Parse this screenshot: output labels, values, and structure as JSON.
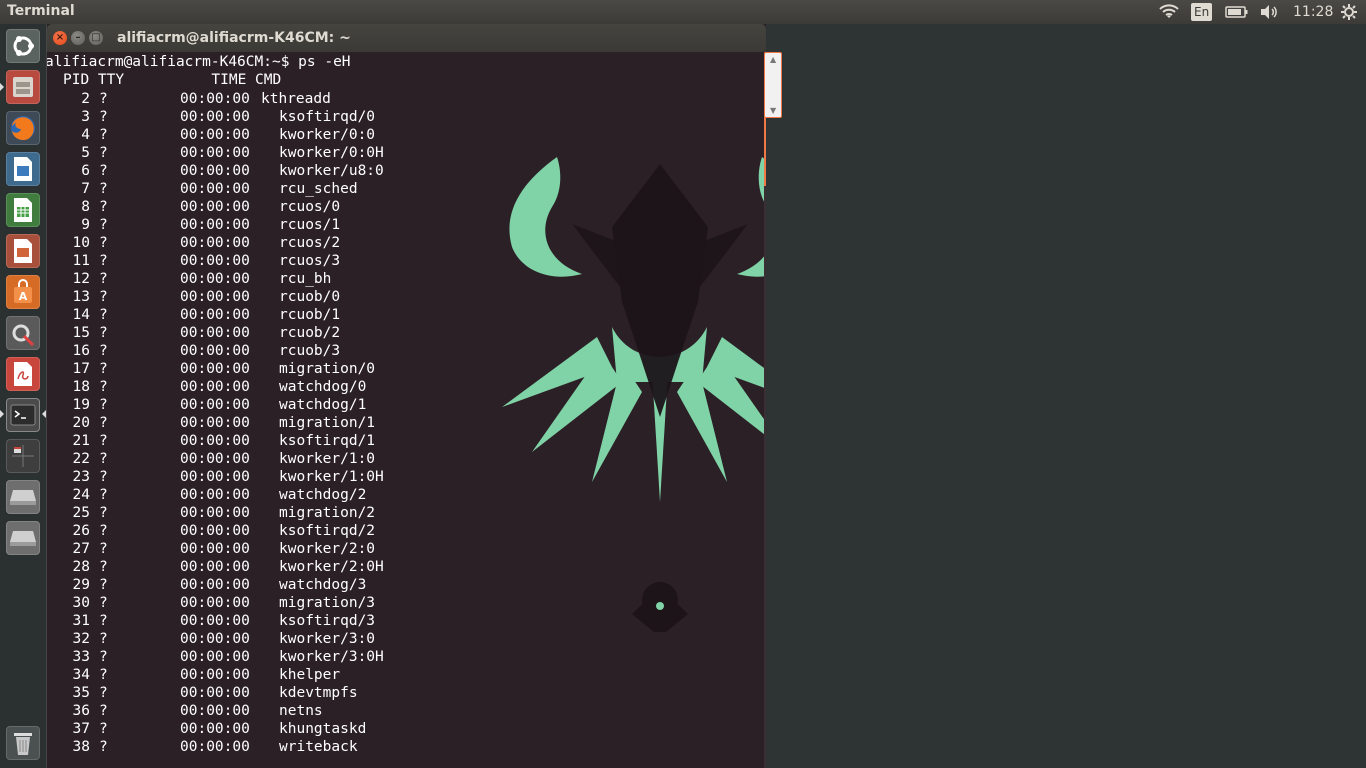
{
  "panel": {
    "app_title": "Terminal",
    "keyboard_layout": "En",
    "clock": "11:28",
    "icons": [
      "wifi-icon",
      "battery-icon",
      "volume-icon",
      "settings-gear-icon"
    ]
  },
  "launcher": {
    "items": [
      "dash-home",
      "files",
      "firefox",
      "libreoffice-writer",
      "libreoffice-calc",
      "libreoffice-impress",
      "ubuntu-software-center",
      "system-settings",
      "document-viewer",
      "terminal",
      "workspace-switcher",
      "drive-1",
      "drive-2",
      "trash"
    ]
  },
  "terminal": {
    "title": "alifiacrm@alifiacrm-K46CM: ~",
    "prompt": "alifiacrm@alifiacrm-K46CM:~$ ps -eH",
    "header": "PID TTY          TIME CMD",
    "rows": [
      {
        "pid": "2",
        "tty": "?",
        "time": "00:00:00",
        "cmd": "kthreadd",
        "indent": false
      },
      {
        "pid": "3",
        "tty": "?",
        "time": "00:00:00",
        "cmd": "ksoftirqd/0",
        "indent": true
      },
      {
        "pid": "4",
        "tty": "?",
        "time": "00:00:00",
        "cmd": "kworker/0:0",
        "indent": true
      },
      {
        "pid": "5",
        "tty": "?",
        "time": "00:00:00",
        "cmd": "kworker/0:0H",
        "indent": true
      },
      {
        "pid": "6",
        "tty": "?",
        "time": "00:00:00",
        "cmd": "kworker/u8:0",
        "indent": true
      },
      {
        "pid": "7",
        "tty": "?",
        "time": "00:00:00",
        "cmd": "rcu_sched",
        "indent": true
      },
      {
        "pid": "8",
        "tty": "?",
        "time": "00:00:00",
        "cmd": "rcuos/0",
        "indent": true
      },
      {
        "pid": "9",
        "tty": "?",
        "time": "00:00:00",
        "cmd": "rcuos/1",
        "indent": true
      },
      {
        "pid": "10",
        "tty": "?",
        "time": "00:00:00",
        "cmd": "rcuos/2",
        "indent": true
      },
      {
        "pid": "11",
        "tty": "?",
        "time": "00:00:00",
        "cmd": "rcuos/3",
        "indent": true
      },
      {
        "pid": "12",
        "tty": "?",
        "time": "00:00:00",
        "cmd": "rcu_bh",
        "indent": true
      },
      {
        "pid": "13",
        "tty": "?",
        "time": "00:00:00",
        "cmd": "rcuob/0",
        "indent": true
      },
      {
        "pid": "14",
        "tty": "?",
        "time": "00:00:00",
        "cmd": "rcuob/1",
        "indent": true
      },
      {
        "pid": "15",
        "tty": "?",
        "time": "00:00:00",
        "cmd": "rcuob/2",
        "indent": true
      },
      {
        "pid": "16",
        "tty": "?",
        "time": "00:00:00",
        "cmd": "rcuob/3",
        "indent": true
      },
      {
        "pid": "17",
        "tty": "?",
        "time": "00:00:00",
        "cmd": "migration/0",
        "indent": true
      },
      {
        "pid": "18",
        "tty": "?",
        "time": "00:00:00",
        "cmd": "watchdog/0",
        "indent": true
      },
      {
        "pid": "19",
        "tty": "?",
        "time": "00:00:00",
        "cmd": "watchdog/1",
        "indent": true
      },
      {
        "pid": "20",
        "tty": "?",
        "time": "00:00:00",
        "cmd": "migration/1",
        "indent": true
      },
      {
        "pid": "21",
        "tty": "?",
        "time": "00:00:00",
        "cmd": "ksoftirqd/1",
        "indent": true
      },
      {
        "pid": "22",
        "tty": "?",
        "time": "00:00:00",
        "cmd": "kworker/1:0",
        "indent": true
      },
      {
        "pid": "23",
        "tty": "?",
        "time": "00:00:00",
        "cmd": "kworker/1:0H",
        "indent": true
      },
      {
        "pid": "24",
        "tty": "?",
        "time": "00:00:00",
        "cmd": "watchdog/2",
        "indent": true
      },
      {
        "pid": "25",
        "tty": "?",
        "time": "00:00:00",
        "cmd": "migration/2",
        "indent": true
      },
      {
        "pid": "26",
        "tty": "?",
        "time": "00:00:00",
        "cmd": "ksoftirqd/2",
        "indent": true
      },
      {
        "pid": "27",
        "tty": "?",
        "time": "00:00:00",
        "cmd": "kworker/2:0",
        "indent": true
      },
      {
        "pid": "28",
        "tty": "?",
        "time": "00:00:00",
        "cmd": "kworker/2:0H",
        "indent": true
      },
      {
        "pid": "29",
        "tty": "?",
        "time": "00:00:00",
        "cmd": "watchdog/3",
        "indent": true
      },
      {
        "pid": "30",
        "tty": "?",
        "time": "00:00:00",
        "cmd": "migration/3",
        "indent": true
      },
      {
        "pid": "31",
        "tty": "?",
        "time": "00:00:00",
        "cmd": "ksoftirqd/3",
        "indent": true
      },
      {
        "pid": "32",
        "tty": "?",
        "time": "00:00:00",
        "cmd": "kworker/3:0",
        "indent": true
      },
      {
        "pid": "33",
        "tty": "?",
        "time": "00:00:00",
        "cmd": "kworker/3:0H",
        "indent": true
      },
      {
        "pid": "34",
        "tty": "?",
        "time": "00:00:00",
        "cmd": "khelper",
        "indent": true
      },
      {
        "pid": "35",
        "tty": "?",
        "time": "00:00:00",
        "cmd": "kdevtmpfs",
        "indent": true
      },
      {
        "pid": "36",
        "tty": "?",
        "time": "00:00:00",
        "cmd": "netns",
        "indent": true
      },
      {
        "pid": "37",
        "tty": "?",
        "time": "00:00:00",
        "cmd": "khungtaskd",
        "indent": true
      },
      {
        "pid": "38",
        "tty": "?",
        "time": "00:00:00",
        "cmd": "writeback",
        "indent": true
      }
    ]
  },
  "colors": {
    "terminal_bg": "#2c2027",
    "accent_orange": "#f07746",
    "logo_green": "#7fd3a6"
  }
}
